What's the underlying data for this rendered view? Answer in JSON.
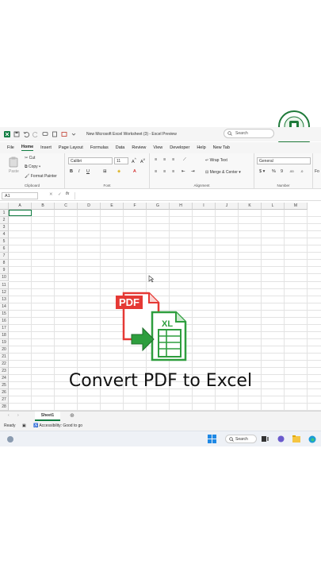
{
  "window": {
    "title": "New Microsoft Excel Worksheet (3) - Excel Preview",
    "search_placeholder": "Search"
  },
  "menu": [
    "File",
    "Home",
    "Insert",
    "Page Layout",
    "Formulas",
    "Data",
    "Review",
    "View",
    "Developer",
    "Help",
    "New Tab"
  ],
  "ribbon": {
    "paste": "Paste",
    "cut": "Cut",
    "copy": "Copy",
    "format_painter": "Format Painter",
    "clipboard_label": "Clipboard",
    "font_name": "Calibri",
    "font_size": "11",
    "font_label": "Font",
    "wrap_text": "Wrap Text",
    "merge_center": "Merge & Center",
    "alignment_label": "Alignment",
    "number_format": "General",
    "number_label": "Number",
    "extra": "Fo"
  },
  "formula_bar": {
    "name_box": "A1",
    "fx": "fx"
  },
  "columns": [
    "A",
    "B",
    "C",
    "D",
    "E",
    "F",
    "G",
    "H",
    "I",
    "J",
    "K",
    "L",
    "M"
  ],
  "rows": [
    "1",
    "2",
    "3",
    "4",
    "5",
    "6",
    "7",
    "8",
    "9",
    "10",
    "11",
    "12",
    "13",
    "14",
    "15",
    "16",
    "17",
    "18",
    "19",
    "20",
    "21",
    "22",
    "23",
    "24",
    "25",
    "26",
    "27",
    "28"
  ],
  "overlay": {
    "pdf_label": "PDF",
    "xl_label": "XL",
    "caption": "Convert PDF to Excel"
  },
  "sheets": [
    "Sheet1"
  ],
  "status": {
    "ready": "Ready",
    "accessibility": "Accessibility: Good to go"
  },
  "taskbar": {
    "search": "Search"
  },
  "colors": {
    "excel_green": "#107c41",
    "pdf_red": "#e53935",
    "arrow_green": "#2e9e3e"
  }
}
